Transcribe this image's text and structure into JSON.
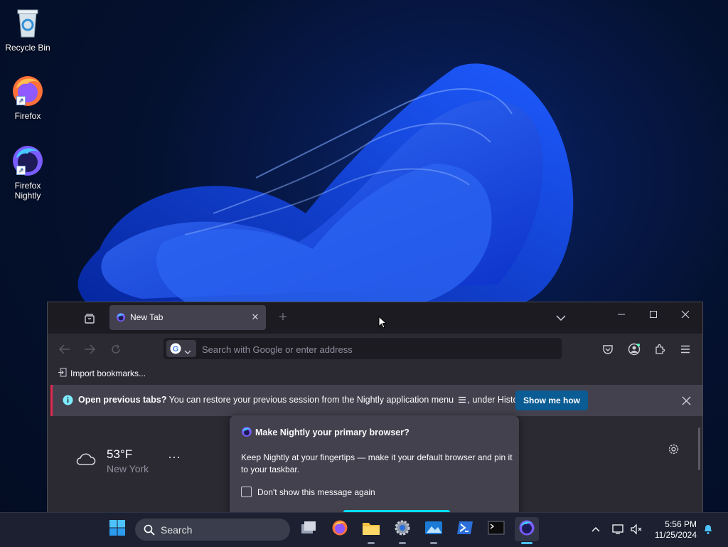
{
  "desktop": {
    "icons": [
      {
        "label": "Recycle Bin",
        "icon": "recycle-bin-icon"
      },
      {
        "label": "Firefox",
        "icon": "firefox-icon"
      },
      {
        "label": "Firefox\nNightly",
        "label_line1": "Firefox",
        "label_line2": "Nightly",
        "icon": "firefox-nightly-icon"
      }
    ]
  },
  "browser": {
    "tab": {
      "title": "New Tab",
      "icon": "nightly-icon"
    },
    "urlbar": {
      "placeholder": "Search with Google or enter address",
      "engine_icon": "google-icon"
    },
    "bookmarks": {
      "import_label": "Import bookmarks..."
    },
    "notification": {
      "bold": "Open previous tabs?",
      "text": "You can restore your previous session from the Nightly application menu",
      "suffix": ", under History.",
      "button": "Show me how"
    },
    "weather": {
      "temp": "53°F",
      "city": "New York"
    },
    "colors": {
      "accent": "#0b5c94",
      "notification_stripe": "#e22850",
      "toolbar_bg": "#2b2a33",
      "tabbar_bg": "#1c1b22"
    }
  },
  "popup": {
    "title": "Make Nightly your primary browser?",
    "body": "Keep Nightly at your fingertips — make it your default browser and pin it to your taskbar.",
    "checkbox_label": "Don't show this message again"
  },
  "taskbar": {
    "search_label": "Search",
    "apps": [
      "task-view-icon",
      "firefox-icon",
      "file-explorer-icon",
      "settings-icon",
      "photos-icon",
      "powershell-icon",
      "terminal-icon",
      "firefox-nightly-icon"
    ],
    "time": "5:56 PM",
    "date": "11/25/2024"
  }
}
